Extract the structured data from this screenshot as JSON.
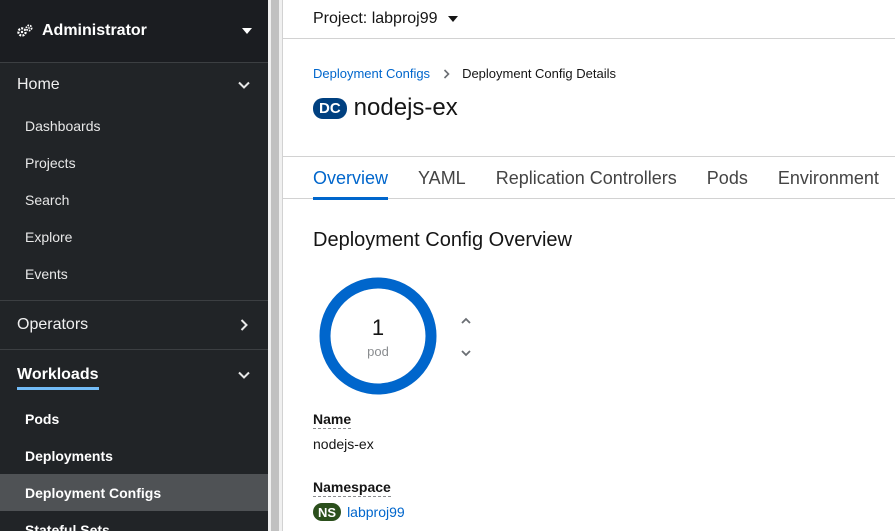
{
  "sidebar": {
    "perspective": {
      "label": "Administrator",
      "icon": "cogs-icon"
    },
    "sections": {
      "home": {
        "label": "Home",
        "items": [
          "Dashboards",
          "Projects",
          "Search",
          "Explore",
          "Events"
        ]
      },
      "operators": {
        "label": "Operators"
      },
      "workloads": {
        "label": "Workloads",
        "items": [
          "Pods",
          "Deployments",
          "Deployment Configs",
          "Stateful Sets"
        ]
      }
    }
  },
  "project_bar": {
    "label": "Project: labproj99"
  },
  "breadcrumb": {
    "parent": "Deployment Configs",
    "current": "Deployment Config Details"
  },
  "header": {
    "badge": "DC",
    "title": "nodejs-ex"
  },
  "tabs": [
    "Overview",
    "YAML",
    "Replication Controllers",
    "Pods",
    "Environment"
  ],
  "overview": {
    "section_title": "Deployment Config Overview",
    "pods": {
      "count": "1",
      "unit": "pod",
      "ring_fraction": 1.0
    },
    "name_label": "Name",
    "name_value": "nodejs-ex",
    "namespace_label": "Namespace",
    "namespace_badge": "NS",
    "namespace_value": "labproj99"
  },
  "colors": {
    "accent": "#0066cc",
    "sidebar_bg": "#212427",
    "dc_badge": "#004080",
    "ns_badge": "#2b4f1c",
    "ring": "#0066cc"
  }
}
